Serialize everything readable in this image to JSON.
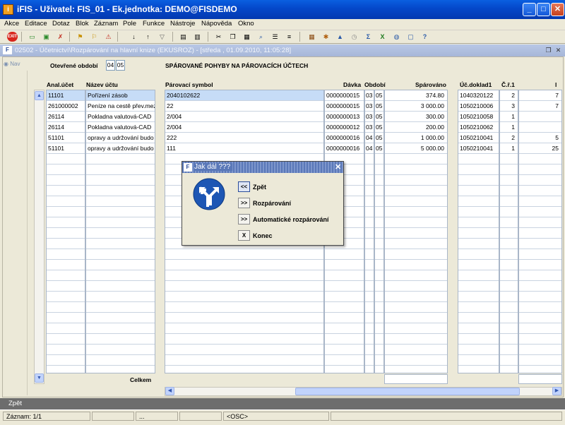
{
  "window": {
    "title": "iFIS - Uživatel: FIS_01 - Ek.jednotka: DEMO@FISDEMO"
  },
  "menu": [
    "Akce",
    "Editace",
    "Dotaz",
    "Blok",
    "Záznam",
    "Pole",
    "Funkce",
    "Nástroje",
    "Nápověda",
    "Okno"
  ],
  "toolbar": {
    "exit_label": "EXIT"
  },
  "inner_window": {
    "title": "02502 - Účetnictví\\Rozpárování na hlavní knize (EKUSROZ) - [středa , 01.09.2010, 11:05:28]"
  },
  "nav": {
    "label": "Nav"
  },
  "period": {
    "label": "Otevřené období",
    "from": "04",
    "to": "05"
  },
  "section_title": "SPÁROVANÉ POHYBY NA PÁROVACÍCH ÚČTECH",
  "columns": {
    "anal_ucet": "Anal.účet",
    "nazev_uctu": "Název účtu",
    "parovaci_symbol": "Párovací symbol",
    "davka": "Dávka",
    "obdobi": "Období",
    "sparovano": "Spárováno",
    "uc_doklad": "Úč.doklad1",
    "cr": "Č.ř.1"
  },
  "rows": [
    {
      "anal": "11101",
      "nazev": "Pořízení zásob",
      "symbol": "2040102622",
      "davka": "0000000015",
      "o1": "03",
      "o2": "05",
      "sparovano": "374.80",
      "doklad": "1040320122",
      "cr": "2",
      "extra": "7"
    },
    {
      "anal": "261000002",
      "nazev": "Peníze na cestě přev.mez",
      "symbol": "22",
      "davka": "0000000015",
      "o1": "03",
      "o2": "05",
      "sparovano": "3 000.00",
      "doklad": "1050210006",
      "cr": "3",
      "extra": "7"
    },
    {
      "anal": "26114",
      "nazev": "Pokladna valutová-CAD",
      "symbol": "2/004",
      "davka": "0000000013",
      "o1": "03",
      "o2": "05",
      "sparovano": "300.00",
      "doklad": "1050210058",
      "cr": "1",
      "extra": ""
    },
    {
      "anal": "26114",
      "nazev": "Pokladna valutová-CAD",
      "symbol": "2/004",
      "davka": "0000000012",
      "o1": "03",
      "o2": "05",
      "sparovano": "200.00",
      "doklad": "1050210062",
      "cr": "1",
      "extra": ""
    },
    {
      "anal": "51101",
      "nazev": "opravy a udržování budo",
      "symbol": "222",
      "davka": "0000000016",
      "o1": "04",
      "o2": "05",
      "sparovano": "1 000.00",
      "doklad": "1050210041",
      "cr": "2",
      "extra": "5"
    },
    {
      "anal": "51101",
      "nazev": "opravy a udržování budo",
      "symbol": "111",
      "davka": "0000000016",
      "o1": "04",
      "o2": "05",
      "sparovano": "5 000.00",
      "doklad": "1050210041",
      "cr": "1",
      "extra": "25"
    }
  ],
  "total_label": "Celkem",
  "dialog": {
    "title": "Jak dál ???",
    "options": [
      {
        "btn": "<<",
        "label": "Zpět"
      },
      {
        "btn": ">>",
        "label": "Rozpárování"
      },
      {
        "btn": ">>",
        "label": "Automatické rozpárování"
      },
      {
        "btn": "X",
        "label": "Konec"
      }
    ]
  },
  "hint": "Zpět",
  "status": {
    "record": "Záznam: 1/1",
    "dots": "...",
    "osc": "<OSC>"
  }
}
